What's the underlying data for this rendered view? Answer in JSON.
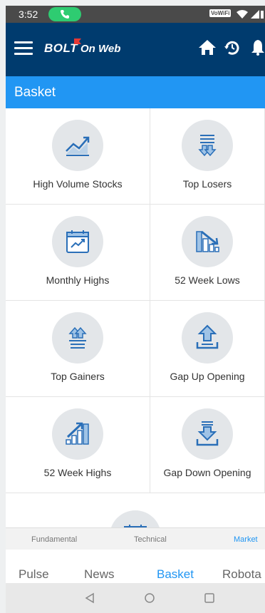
{
  "status_bar": {
    "time": "3:52",
    "network_badge": "VoWiFi"
  },
  "app_bar": {
    "logo_text": "BOLT",
    "logo_suffix": "On Web"
  },
  "section": {
    "title": "Basket"
  },
  "baskets": [
    {
      "label": "High Volume Stocks",
      "icon": "chart-up-icon"
    },
    {
      "label": "Top Losers",
      "icon": "down-arrows-icon"
    },
    {
      "label": "Monthly Highs",
      "icon": "calendar-chart-icon"
    },
    {
      "label": "52 Week Lows",
      "icon": "bars-down-icon"
    },
    {
      "label": "Top Gainers",
      "icon": "up-arrows-icon"
    },
    {
      "label": "Gap Up Opening",
      "icon": "arrow-up-tray-icon"
    },
    {
      "label": "52 Week Highs",
      "icon": "bars-up-icon"
    },
    {
      "label": "Gap Down Opening",
      "icon": "arrow-down-tray-icon"
    }
  ],
  "sub_tabs": [
    "Fundamental",
    "Technical",
    "Market"
  ],
  "bottom_tabs": [
    "Pulse",
    "News",
    "Basket",
    "Robota"
  ],
  "colors": {
    "app_bar": "#003b6e",
    "section_header": "#2196f3",
    "accent": "#2196f3",
    "icon_circle": "#e3e6e9",
    "icon_stroke": "#2a6fb8",
    "call_pill": "#2ecc71"
  }
}
